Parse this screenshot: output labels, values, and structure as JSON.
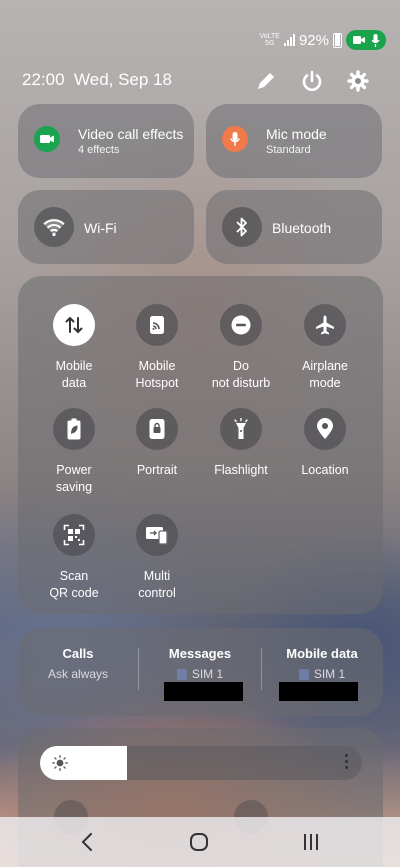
{
  "status": {
    "network": "VoLTE",
    "network2": "5G",
    "battery": "92%"
  },
  "header": {
    "time": "22:00",
    "date": "Wed, Sep 18"
  },
  "tiles": {
    "video": {
      "title": "Video call effects",
      "sub": "4 effects",
      "color": "#1aa351"
    },
    "mic": {
      "title": "Mic mode",
      "sub": "Standard",
      "color": "#f07a4a"
    },
    "wifi": {
      "title": "Wi-Fi"
    },
    "bt": {
      "title": "Bluetooth"
    }
  },
  "toggles": [
    {
      "label": "Mobile data",
      "icon": "mobile-data-icon",
      "on": true
    },
    {
      "label": "Mobile Hotspot",
      "icon": "hotspot-icon",
      "on": false
    },
    {
      "label": "Do not disturb",
      "icon": "dnd-icon",
      "on": false
    },
    {
      "label": "Airplane mode",
      "icon": "airplane-icon",
      "on": false
    },
    {
      "label": "Power saving",
      "icon": "power-saving-icon",
      "on": false
    },
    {
      "label": "Portrait",
      "icon": "portrait-lock-icon",
      "on": false
    },
    {
      "label": "Flashlight",
      "icon": "flashlight-icon",
      "on": false
    },
    {
      "label": "Location",
      "icon": "location-icon",
      "on": false
    },
    {
      "label": "Scan QR code",
      "icon": "qr-scan-icon",
      "on": false
    },
    {
      "label": "Multi control",
      "icon": "multi-control-icon",
      "on": false
    }
  ],
  "sim": {
    "calls": {
      "title": "Calls",
      "value": "Ask always"
    },
    "messages": {
      "title": "Messages",
      "value": "SIM 1"
    },
    "data": {
      "title": "Mobile data",
      "value": "SIM 1"
    }
  },
  "brightness": {
    "level": 0.27
  }
}
